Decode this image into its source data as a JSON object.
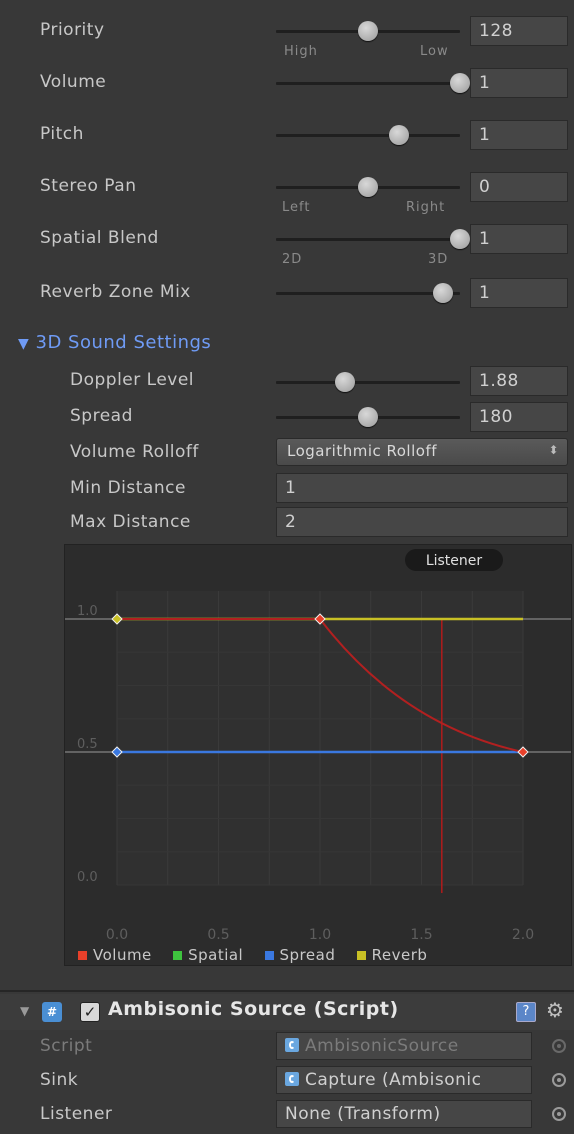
{
  "audio_source": {
    "priority": {
      "label": "Priority",
      "value": "128",
      "fraction": 0.5,
      "left_label": "High",
      "right_label": "Low"
    },
    "volume": {
      "label": "Volume",
      "value": "1",
      "fraction": 1.0
    },
    "pitch": {
      "label": "Pitch",
      "value": "1",
      "fraction": 0.667
    },
    "stereo_pan": {
      "label": "Stereo Pan",
      "value": "0",
      "fraction": 0.5,
      "left_label": "Left",
      "right_label": "Right"
    },
    "spatial_blend": {
      "label": "Spatial Blend",
      "value": "1",
      "fraction": 1.0,
      "left_label": "2D",
      "right_label": "3D"
    },
    "reverb_zone_mix": {
      "label": "Reverb Zone Mix",
      "value": "1",
      "fraction": 0.909
    }
  },
  "sound_3d": {
    "section_label": "3D Sound Settings",
    "doppler_level": {
      "label": "Doppler Level",
      "value": "1.88",
      "fraction": 0.376
    },
    "spread": {
      "label": "Spread",
      "value": "180",
      "fraction": 0.5
    },
    "volume_rolloff": {
      "label": "Volume Rolloff",
      "value": "Logarithmic Rolloff"
    },
    "min_distance": {
      "label": "Min Distance",
      "value": "1"
    },
    "max_distance": {
      "label": "Max Distance",
      "value": "2"
    }
  },
  "chart_data": {
    "type": "line",
    "tooltip": "Listener",
    "listener_x": 1.6,
    "xlim": [
      0,
      2.0
    ],
    "ylim": [
      0,
      1.0
    ],
    "x_ticks": [
      "0.0",
      "0.5",
      "1.0",
      "1.5",
      "2.0"
    ],
    "y_ticks": [
      "0.0",
      "0.5",
      "1.0"
    ],
    "series": [
      {
        "name": "Volume",
        "color": "#e8402a",
        "points": [
          [
            0,
            1.0
          ],
          [
            1.0,
            1.0
          ],
          [
            1.2,
            0.83
          ],
          [
            1.4,
            0.71
          ],
          [
            1.6,
            0.62
          ],
          [
            1.8,
            0.55
          ],
          [
            2.0,
            0.5
          ]
        ]
      },
      {
        "name": "Spatial",
        "color": "#3ec43e",
        "points": []
      },
      {
        "name": "Spread",
        "color": "#3a78e0",
        "points": [
          [
            0,
            0.5
          ],
          [
            2.0,
            0.5
          ]
        ]
      },
      {
        "name": "Reverb",
        "color": "#c8c025",
        "points": [
          [
            0,
            1.0
          ],
          [
            2.0,
            1.0
          ]
        ]
      }
    ]
  },
  "ambisonic_source": {
    "title": "Ambisonic Source (Script)",
    "script": {
      "label": "Script",
      "value": "AmbisonicSource"
    },
    "sink": {
      "label": "Sink",
      "value": "Capture (Ambisonic"
    },
    "listener": {
      "label": "Listener",
      "value": "None (Transform)"
    }
  },
  "icons": {
    "foldout_open": "▼",
    "checkbox_checked": "✓"
  },
  "colors": {
    "section_blue": "#6f9bf5",
    "volume_red": "#e8402a",
    "spread_blue": "#3a78e0",
    "reverb_yellow": "#c8c025",
    "spatial_green": "#3ec43e"
  }
}
